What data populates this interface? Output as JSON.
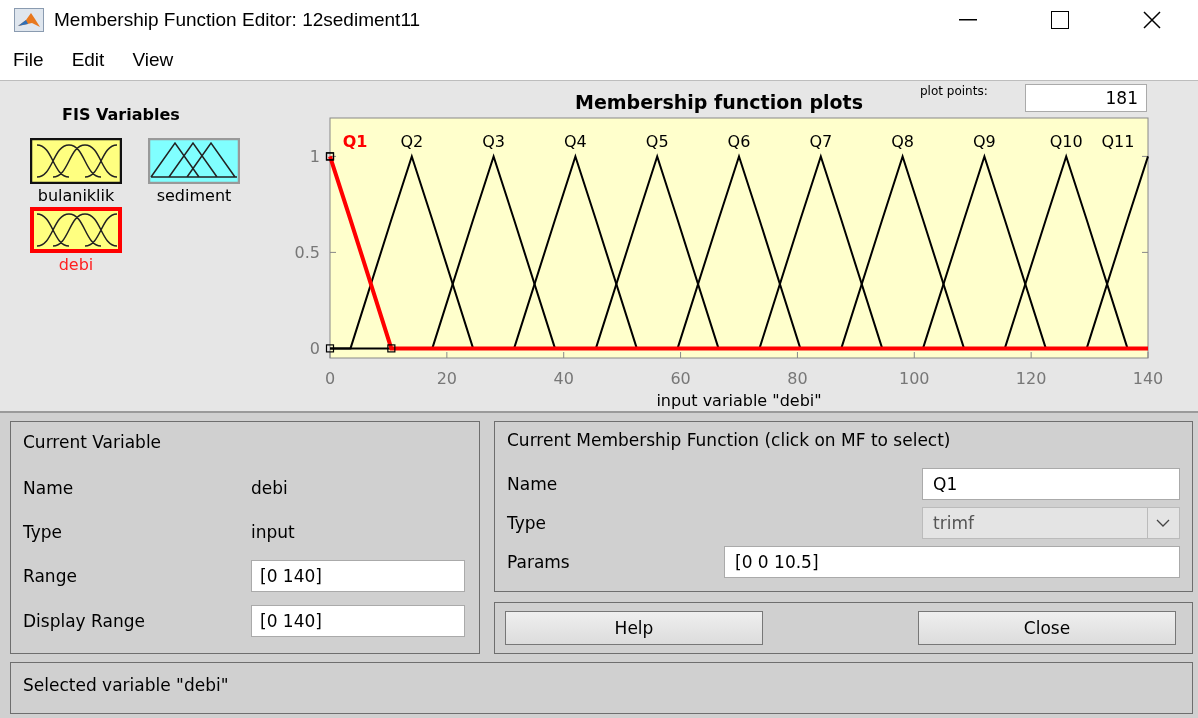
{
  "window": {
    "title": "Membership Function Editor: 12sediment11"
  },
  "menu": [
    "File",
    "Edit",
    "View"
  ],
  "fis_variables": {
    "title": "FIS Variables",
    "items": [
      {
        "name": "bulaniklik",
        "kind": "input",
        "selected": false
      },
      {
        "name": "sediment",
        "kind": "output",
        "selected": false
      },
      {
        "name": "debi",
        "kind": "input",
        "selected": true
      }
    ]
  },
  "plot": {
    "title": "Membership function plots",
    "plot_points_label": "plot points:",
    "plot_points": "181",
    "membership_functions": [
      {
        "selected": true
      },
      {
        "selected": false
      },
      {
        "selected": false
      },
      {
        "selected": false
      },
      {
        "selected": false
      },
      {
        "selected": false
      },
      {
        "selected": false
      },
      {
        "selected": false
      },
      {
        "selected": false
      },
      {
        "selected": false
      },
      {
        "selected": false
      }
    ],
    "chart_data": {
      "type": "line",
      "xlabel": "input variable \"debi\"",
      "xlim": [
        0,
        140
      ],
      "ylim": [
        -0.05,
        1.2
      ],
      "xticks": [
        0,
        20,
        40,
        60,
        80,
        100,
        120,
        140
      ],
      "yticks": [
        0,
        0.5,
        1
      ],
      "x": [
        0,
        3.5,
        10.5,
        14,
        17.5,
        24.5,
        28,
        31.5,
        38.5,
        42,
        45.5,
        52.5,
        56,
        59.5,
        66.5,
        70,
        73.5,
        80.5,
        84,
        87.5,
        94.5,
        98,
        101.5,
        108.5,
        112,
        115.5,
        122.5,
        126,
        129.5,
        136.5,
        140
      ],
      "series": [
        {
          "name": "Q1",
          "color": "#ff0000",
          "values": [
            1,
            0.67,
            0,
            0,
            0,
            0,
            0,
            0,
            0,
            0,
            0,
            0,
            0,
            0,
            0,
            0,
            0,
            0,
            0,
            0,
            0,
            0,
            0,
            0,
            0,
            0,
            0,
            0,
            0,
            0,
            0
          ]
        },
        {
          "name": "Q2",
          "color": "#000000",
          "values": [
            0,
            0,
            0.67,
            1,
            0.67,
            0,
            null,
            null,
            null,
            null,
            null,
            null,
            null,
            null,
            null,
            null,
            null,
            null,
            null,
            null,
            null,
            null,
            null,
            null,
            null,
            null,
            null,
            null,
            null,
            null,
            null
          ]
        },
        {
          "name": "Q3",
          "color": "#000000",
          "values": [
            null,
            null,
            null,
            null,
            0,
            0.67,
            1,
            0.67,
            0,
            null,
            null,
            null,
            null,
            null,
            null,
            null,
            null,
            null,
            null,
            null,
            null,
            null,
            null,
            null,
            null,
            null,
            null,
            null,
            null,
            null,
            null
          ]
        },
        {
          "name": "Q4",
          "color": "#000000",
          "values": [
            null,
            null,
            null,
            null,
            null,
            null,
            null,
            0,
            0.67,
            1,
            0.67,
            0,
            null,
            null,
            null,
            null,
            null,
            null,
            null,
            null,
            null,
            null,
            null,
            null,
            null,
            null,
            null,
            null,
            null,
            null,
            null
          ]
        },
        {
          "name": "Q5",
          "color": "#000000",
          "values": [
            null,
            null,
            null,
            null,
            null,
            null,
            null,
            null,
            null,
            null,
            0,
            0.67,
            1,
            0.67,
            0,
            null,
            null,
            null,
            null,
            null,
            null,
            null,
            null,
            null,
            null,
            null,
            null,
            null,
            null,
            null,
            null
          ]
        },
        {
          "name": "Q6",
          "color": "#000000",
          "values": [
            null,
            null,
            null,
            null,
            null,
            null,
            null,
            null,
            null,
            null,
            null,
            null,
            null,
            0,
            0.67,
            1,
            0.67,
            0,
            null,
            null,
            null,
            null,
            null,
            null,
            null,
            null,
            null,
            null,
            null,
            null,
            null
          ]
        },
        {
          "name": "Q7",
          "color": "#000000",
          "values": [
            null,
            null,
            null,
            null,
            null,
            null,
            null,
            null,
            null,
            null,
            null,
            null,
            null,
            null,
            null,
            null,
            0,
            0.67,
            1,
            0.67,
            0,
            null,
            null,
            null,
            null,
            null,
            null,
            null,
            null,
            null,
            null
          ]
        },
        {
          "name": "Q8",
          "color": "#000000",
          "values": [
            null,
            null,
            null,
            null,
            null,
            null,
            null,
            null,
            null,
            null,
            null,
            null,
            null,
            null,
            null,
            null,
            null,
            null,
            null,
            0,
            0.67,
            1,
            0.67,
            0,
            null,
            null,
            null,
            null,
            null,
            null,
            null
          ]
        },
        {
          "name": "Q9",
          "color": "#000000",
          "values": [
            null,
            null,
            null,
            null,
            null,
            null,
            null,
            null,
            null,
            null,
            null,
            null,
            null,
            null,
            null,
            null,
            null,
            null,
            null,
            null,
            null,
            null,
            0,
            0.67,
            1,
            0.67,
            0,
            null,
            null,
            null,
            null
          ]
        },
        {
          "name": "Q10",
          "color": "#000000",
          "values": [
            null,
            null,
            null,
            null,
            null,
            null,
            null,
            null,
            null,
            null,
            null,
            null,
            null,
            null,
            null,
            null,
            null,
            null,
            null,
            null,
            null,
            null,
            null,
            null,
            null,
            0,
            0.67,
            1,
            0.67,
            0,
            null
          ]
        },
        {
          "name": "Q11",
          "color": "#000000",
          "values": [
            null,
            null,
            null,
            null,
            null,
            null,
            null,
            null,
            null,
            null,
            null,
            null,
            null,
            null,
            null,
            null,
            null,
            null,
            null,
            null,
            null,
            null,
            null,
            null,
            null,
            null,
            null,
            null,
            0,
            0.67,
            1
          ]
        }
      ]
    }
  },
  "current_variable": {
    "title": "Current Variable",
    "name_label": "Name",
    "name": "debi",
    "type_label": "Type",
    "type": "input",
    "range_label": "Range",
    "range": "[0 140]",
    "display_range_label": "Display Range",
    "display_range": "[0 140]"
  },
  "current_mf": {
    "title": "Current Membership Function (click on MF to select)",
    "name_label": "Name",
    "name": "Q1",
    "type_label": "Type",
    "type": "trimf",
    "params_label": "Params",
    "params": "[0 0 10.5]"
  },
  "buttons": [
    "Help",
    "Close"
  ],
  "status": "Selected variable \"debi\""
}
